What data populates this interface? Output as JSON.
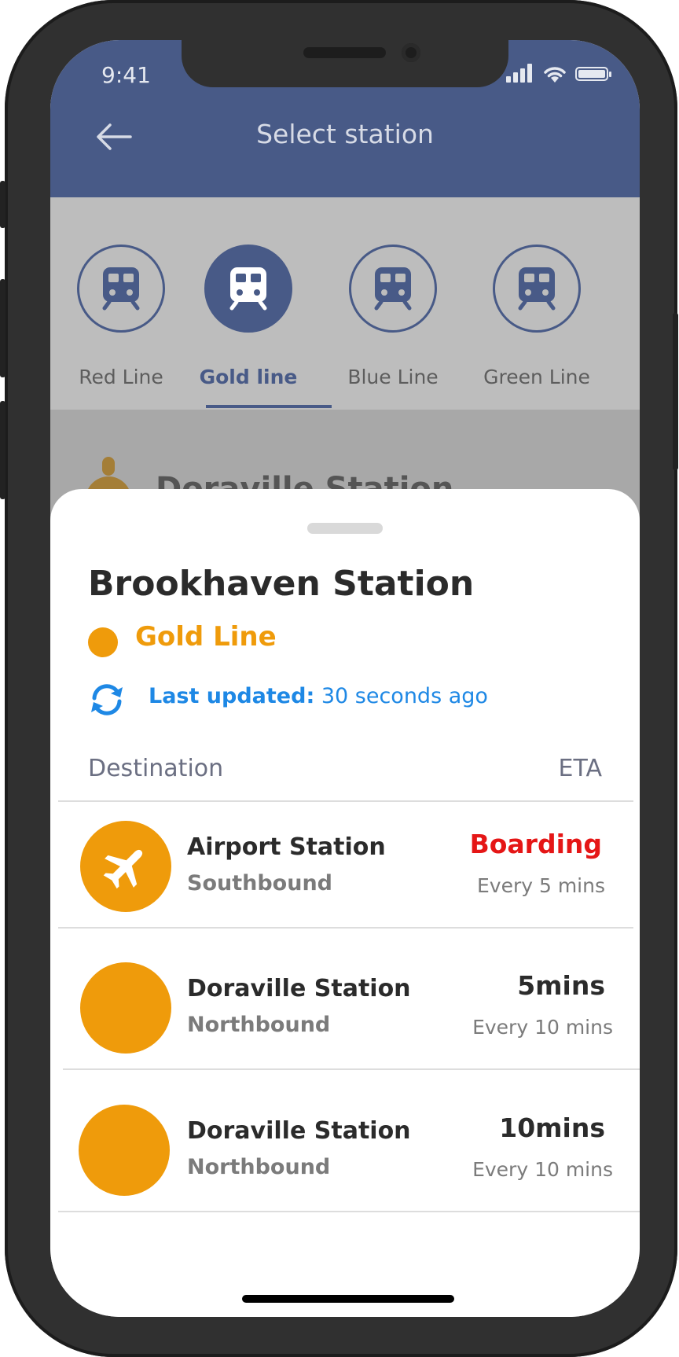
{
  "status_bar": {
    "time": "9:41"
  },
  "header": {
    "title": "Select station"
  },
  "tabs": [
    {
      "label": "Red Line",
      "active": false
    },
    {
      "label": "Gold line",
      "active": true
    },
    {
      "label": "Blue Line",
      "active": false
    },
    {
      "label": "Green Line",
      "active": false
    }
  ],
  "background_list": {
    "partial_item_text": "Doraville Station"
  },
  "sheet": {
    "station_name": "Brookhaven Station",
    "line_name": "Gold Line",
    "updated_label": "Last updated:",
    "updated_value": "30 seconds ago",
    "column_destination": "Destination",
    "column_eta": "ETA",
    "rows": [
      {
        "title": "Airport Station",
        "direction": "Southbound",
        "eta": "Boarding",
        "frequency": "Every 5 mins",
        "icon": "airplane-icon"
      },
      {
        "title": "Doraville Station",
        "direction": "Northbound",
        "eta": "5mins",
        "frequency": "Every 10 mins",
        "icon": ""
      },
      {
        "title": "Doraville Station",
        "direction": "Northbound",
        "eta": "10mins",
        "frequency": "Every 10 mins",
        "icon": ""
      }
    ]
  },
  "colors": {
    "header": "#485a87",
    "gold": "#ef9b0b",
    "boarding": "#e51616",
    "link_blue": "#1e88e5"
  }
}
